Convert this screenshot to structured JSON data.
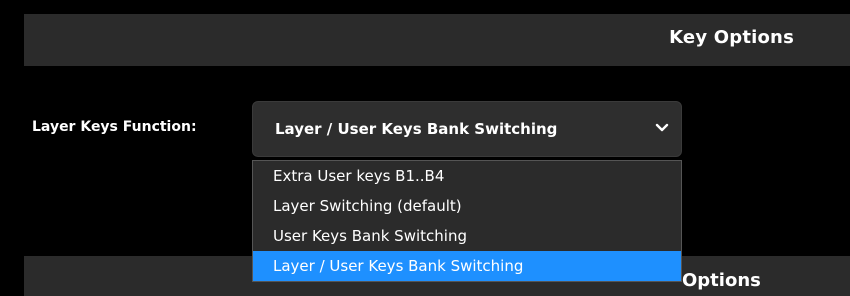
{
  "section": {
    "title": "Key Options",
    "next_title": "Options"
  },
  "field": {
    "label": "Layer Keys Function:",
    "selected_value": "Layer / User Keys Bank Switching"
  },
  "dropdown": {
    "icon": "chevron-down-icon",
    "options": [
      "Extra User keys B1..B4",
      "Layer Switching (default)",
      "User Keys Bank Switching",
      "Layer / User Keys Bank Switching"
    ],
    "highlighted_index": 3
  },
  "colors": {
    "background": "#000000",
    "header_bg": "#2b2b2b",
    "select_bg": "#2e2e2e",
    "highlight": "#1e90ff",
    "text": "#ffffff"
  }
}
